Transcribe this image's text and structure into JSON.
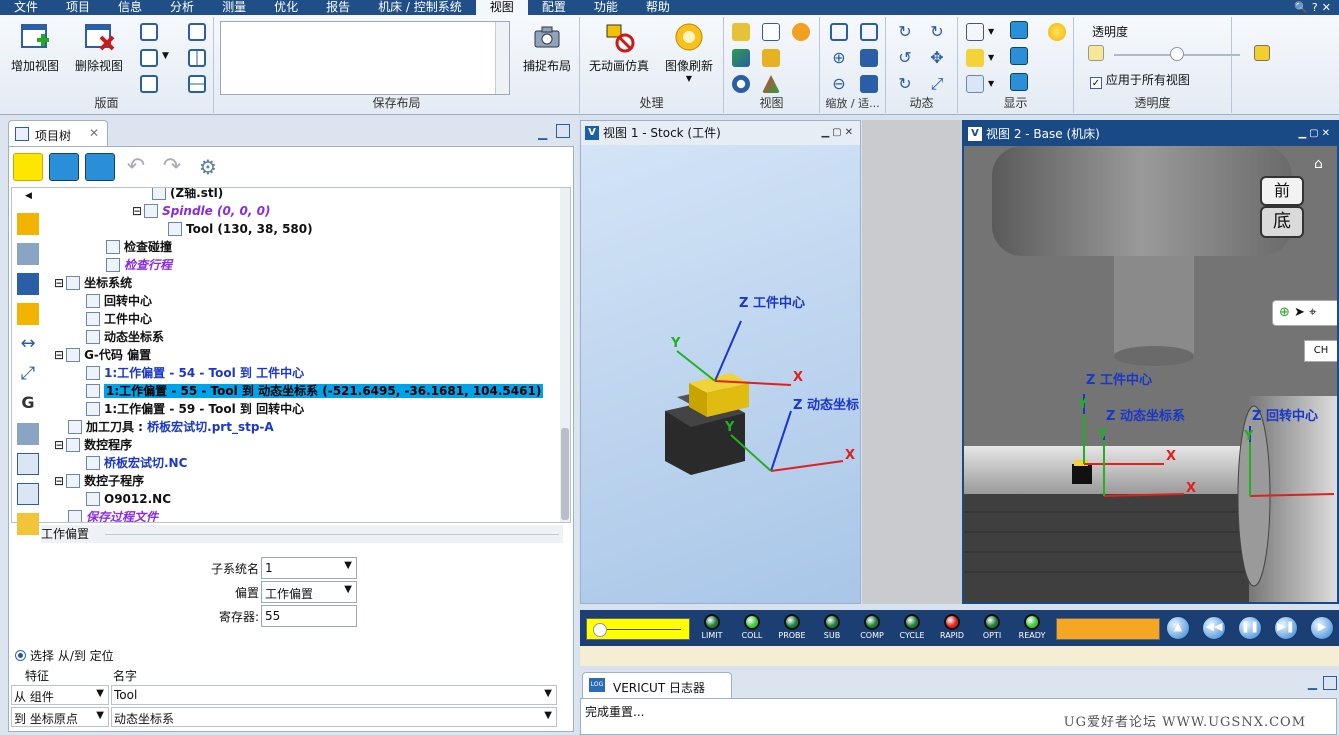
{
  "menu": {
    "items": [
      "文件",
      "项目",
      "信息",
      "分析",
      "测量",
      "优化",
      "报告",
      "机床 / 控制系统",
      "视图",
      "配置",
      "功能",
      "帮助"
    ],
    "active": "视图"
  },
  "ribbon": {
    "groups": {
      "layout": "版面",
      "saved_layout": "保存布局",
      "process": "处理",
      "view": "视图",
      "zoom": "缩放 / 适...",
      "dynamic": "动态",
      "display": "显示",
      "transparency": "透明度"
    },
    "buttons": {
      "add_view": "增加视图",
      "delete_view": "删除视图",
      "capture_layout": "捕捉布局",
      "no_anim_sim": "无动画仿真",
      "image_refresh": "图像刷新"
    },
    "transparency": {
      "title": "透明度",
      "apply_all_label": "应用于所有视图",
      "apply_all_checked": true,
      "level": 0.5
    }
  },
  "project_tree": {
    "tab_label": "项目树",
    "rows": [
      {
        "text": "(Z轴.stl)",
        "style": "bold"
      },
      {
        "text": "Spindle (0, 0, 0)",
        "style": "purple"
      },
      {
        "text": "Tool (130, 38, 580)",
        "style": "bold"
      },
      {
        "text": "检查碰撞",
        "style": "bold"
      },
      {
        "text": "检查行程",
        "style": "purple"
      },
      {
        "text": "坐标系统",
        "style": "bold"
      },
      {
        "text": "回转中心",
        "style": "bold"
      },
      {
        "text": "工件中心",
        "style": "bold"
      },
      {
        "text": "动态坐标系",
        "style": "bold"
      },
      {
        "text": "G-代码 偏置",
        "style": "bold"
      },
      {
        "text": "1:工作偏置 - 54 - Tool 到 工件中心",
        "style": "blue"
      },
      {
        "text": "1:工作偏置 - 55 - Tool 到 动态坐标系 (-521.6495, -36.1681, 104.5461)",
        "style": "sel"
      },
      {
        "text": "1:工作偏置 - 59 - Tool 到 回转中心",
        "style": "bold"
      },
      {
        "text": "加工刀具 : 桥板宏试切.prt_stp-A",
        "style": "mixed",
        "prefix": "加工刀具 : ",
        "suffix": "桥板宏试切.prt_stp-A"
      },
      {
        "text": "数控程序",
        "style": "bold"
      },
      {
        "text": "桥板宏试切.NC",
        "style": "blue"
      },
      {
        "text": "数控子程序",
        "style": "bold"
      },
      {
        "text": "O9012.NC",
        "style": "bold"
      },
      {
        "text": "保存过程文件",
        "style": "purple"
      }
    ]
  },
  "work_offset": {
    "section_title": "工作偏置",
    "subsystem_label": "子系统名",
    "subsystem_value": "1",
    "offset_label": "偏置",
    "offset_value": "工作偏置",
    "register_label": "寄存器:",
    "register_value": "55",
    "radio_label": "选择 从/到 定位",
    "col_feature": "特征",
    "col_name": "名字",
    "from_label": "从 组件",
    "from_value": "Tool",
    "to_label": "到 坐标原点",
    "to_value": "动态坐标系"
  },
  "view1": {
    "title": "视图 1 - Stock (工件)",
    "axes": {
      "z_work": "Z 工件中心",
      "z_dyn": "Z 动态坐标",
      "x": "X",
      "y": "Y"
    }
  },
  "view2": {
    "title": "视图 2 - Base (机床)",
    "cube_top": "前",
    "cube_bottom": "底",
    "axes": {
      "z_work": "Z 工件中心",
      "z_dyn": "Z 动态坐标系",
      "z_rot": "Z 回转中心",
      "x": "X",
      "y": "Y"
    },
    "side_label": "CH"
  },
  "sim": {
    "leds": [
      {
        "label": "LIMIT",
        "color": "#1f7a3a"
      },
      {
        "label": "COLL",
        "color": "#3ec63e"
      },
      {
        "label": "PROBE",
        "color": "#1f7a3a"
      },
      {
        "label": "SUB",
        "color": "#1f7a3a"
      },
      {
        "label": "COMP",
        "color": "#1f7a3a"
      },
      {
        "label": "CYCLE",
        "color": "#1f7a3a"
      },
      {
        "label": "RAPID",
        "color": "#e0201a"
      },
      {
        "label": "OPTI",
        "color": "#1f7a3a"
      },
      {
        "label": "READY",
        "color": "#3ec63e"
      }
    ],
    "play_icons": [
      "rewind-icon",
      "step-back-icon",
      "pause-icon",
      "step-forward-icon",
      "play-icon"
    ]
  },
  "log": {
    "tab_label": "VERICUT 日志器",
    "message": "完成重置..."
  },
  "watermark": "UG爱好者论坛 WWW.UGSNX.COM"
}
